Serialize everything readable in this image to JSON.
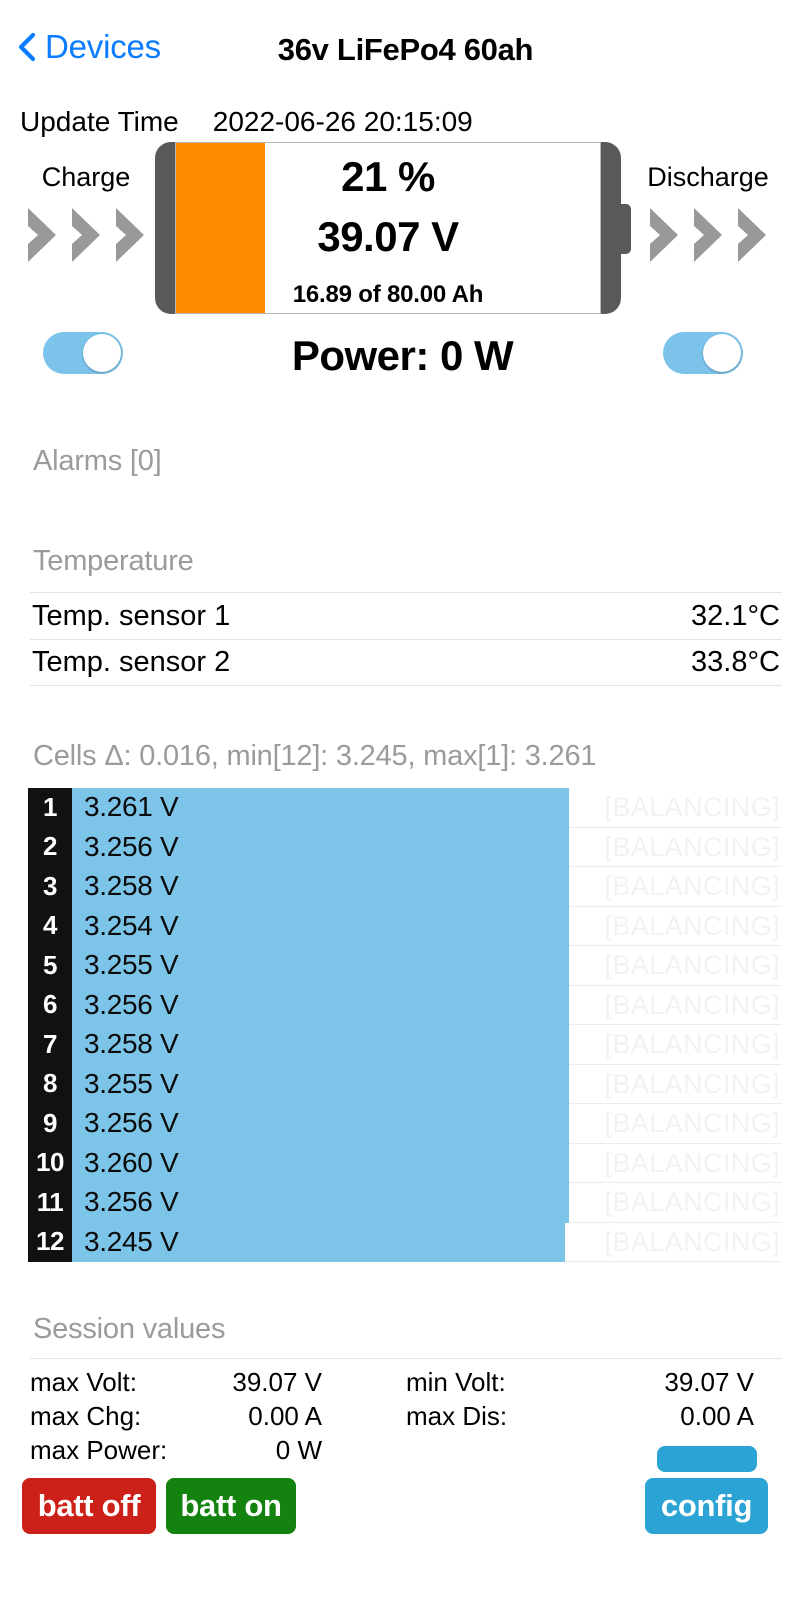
{
  "navbar": {
    "back_label": "Devices",
    "back_icon": "chevron-left-icon",
    "title": "36v LiFePo4 60ah",
    "accent_color": "#0a7cff"
  },
  "update": {
    "label": "Update Time",
    "value": "2022-06-26 20:15:09"
  },
  "battery": {
    "charge_label": "Charge",
    "discharge_label": "Discharge",
    "percent_text": "21 %",
    "percent_value": 21,
    "voltage_text": "39.07 V",
    "capacity_text": "16.89 of 80.00 Ah",
    "power_text": "Power: 0 W",
    "fill_color": "#ff8c00",
    "shell_color": "#595959",
    "arrow_color": "#999999",
    "charge_toggle_on": true,
    "discharge_toggle_on": true,
    "toggle_color": "#7cc3ec"
  },
  "alarms": {
    "header": "Alarms [0]",
    "count": 0
  },
  "temperature": {
    "header": "Temperature",
    "rows": [
      {
        "label": "Temp. sensor 1",
        "value": "32.1°C"
      },
      {
        "label": "Temp. sensor 2",
        "value": "33.8°C"
      }
    ]
  },
  "cells": {
    "header": "Cells Δ: 0.016, min[12]: 3.245, max[1]: 3.261",
    "delta": 0.016,
    "min_index": 12,
    "min_value": 3.245,
    "max_index": 1,
    "max_value": 3.261,
    "balancing_label": "[BALANCING]",
    "bar_color": "#7cc4e8",
    "rows": [
      {
        "index": "1",
        "voltage": "3.261 V",
        "bar_pct": 100.0,
        "balancing": "[BALANCING]"
      },
      {
        "index": "2",
        "voltage": "3.256 V",
        "bar_pct": 100.0,
        "balancing": "[BALANCING]"
      },
      {
        "index": "3",
        "voltage": "3.258 V",
        "bar_pct": 100.0,
        "balancing": "[BALANCING]"
      },
      {
        "index": "4",
        "voltage": "3.254 V",
        "bar_pct": 100.0,
        "balancing": "[BALANCING]"
      },
      {
        "index": "5",
        "voltage": "3.255 V",
        "bar_pct": 100.0,
        "balancing": "[BALANCING]"
      },
      {
        "index": "6",
        "voltage": "3.256 V",
        "bar_pct": 100.0,
        "balancing": "[BALANCING]"
      },
      {
        "index": "7",
        "voltage": "3.258 V",
        "bar_pct": 100.0,
        "balancing": "[BALANCING]"
      },
      {
        "index": "8",
        "voltage": "3.255 V",
        "bar_pct": 100.0,
        "balancing": "[BALANCING]"
      },
      {
        "index": "9",
        "voltage": "3.256 V",
        "bar_pct": 100.0,
        "balancing": "[BALANCING]"
      },
      {
        "index": "10",
        "voltage": "3.260 V",
        "bar_pct": 100.0,
        "balancing": "[BALANCING]"
      },
      {
        "index": "11",
        "voltage": "3.256 V",
        "bar_pct": 100.0,
        "balancing": "[BALANCING]"
      },
      {
        "index": "12",
        "voltage": "3.245 V",
        "bar_pct": 99.2,
        "balancing": "[BALANCING]"
      }
    ]
  },
  "session": {
    "header": "Session values",
    "rows": [
      {
        "left_key": "max Volt:",
        "left_value": "39.07 V",
        "right_key": "min Volt:",
        "right_value": "39.07 V"
      },
      {
        "left_key": "max Chg:",
        "left_value": "0.00 A",
        "right_key": "max Dis:",
        "right_value": "0.00 A"
      },
      {
        "left_key": "max Power:",
        "left_value": "0 W",
        "right_key": "",
        "right_value": ""
      }
    ]
  },
  "buttons": {
    "batt_off": "batt off",
    "batt_on": "batt on",
    "config": "config",
    "batt_off_color": "#cc2118",
    "batt_on_color": "#13820f",
    "config_color": "#2ba3d4"
  }
}
